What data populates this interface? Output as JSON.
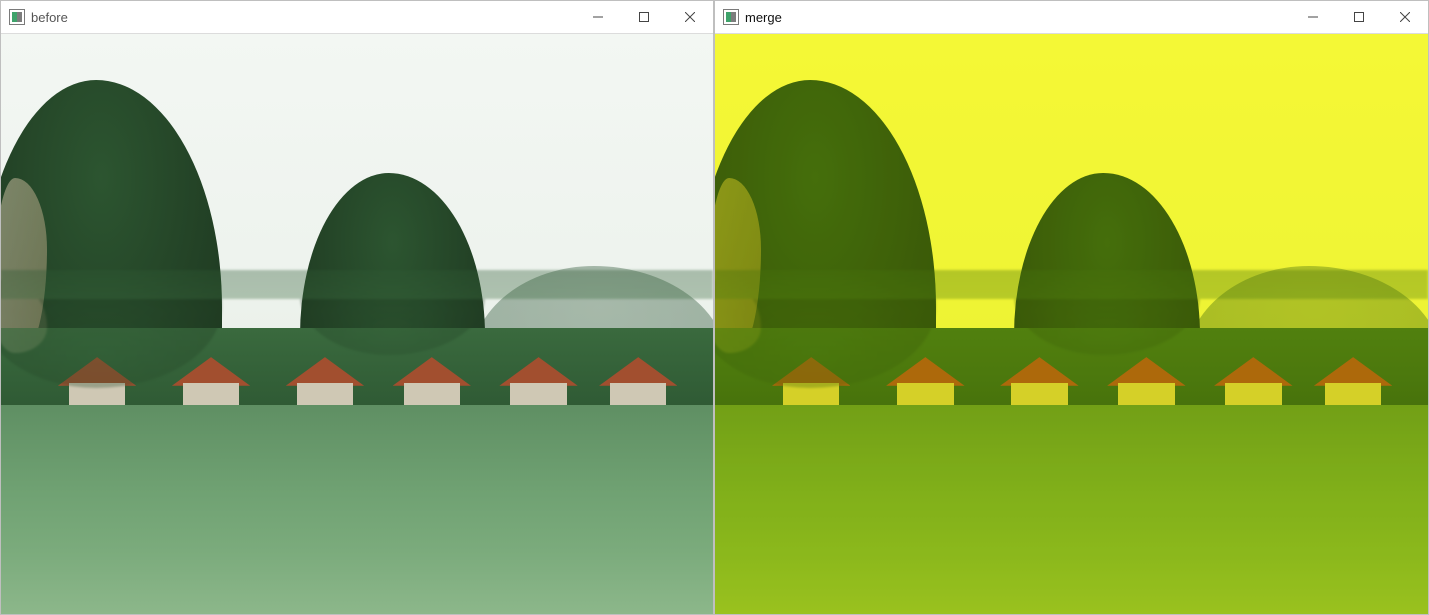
{
  "windows": [
    {
      "title": "before",
      "controls": {
        "minimize": "Minimize",
        "maximize": "Maximize",
        "close": "Close"
      }
    },
    {
      "title": "merge",
      "controls": {
        "minimize": "Minimize",
        "maximize": "Maximize",
        "close": "Close"
      }
    }
  ]
}
